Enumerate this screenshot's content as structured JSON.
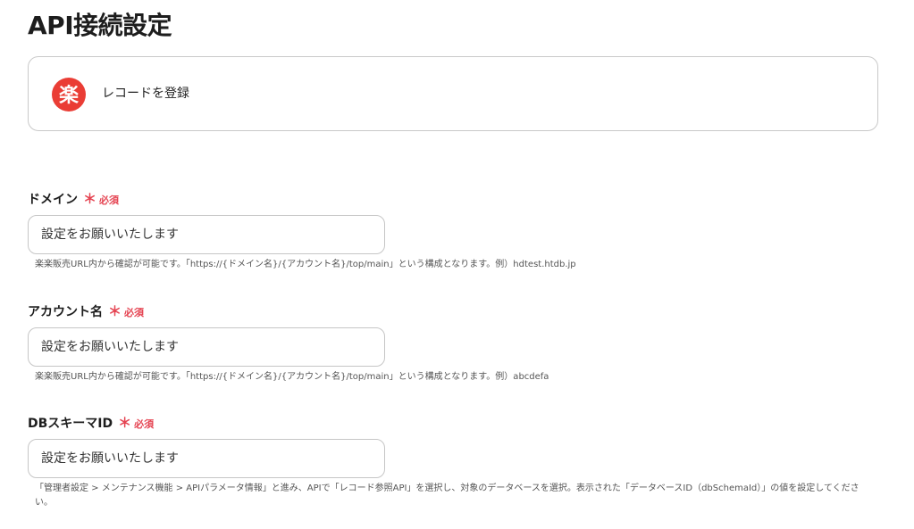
{
  "page": {
    "title": "API接続設定"
  },
  "app_card": {
    "logo_icon": "rakuten-logo-icon",
    "logo_char": "楽",
    "logo_color": "#ea3d35",
    "action": "レコードを登録"
  },
  "colors": {
    "required": "#e54452",
    "border": "#c6c6c6"
  },
  "fields": [
    {
      "label": "ドメイン",
      "required_mark": "＊",
      "required_text": "必須",
      "placeholder": "設定をお願いいたします",
      "help": "楽楽販売URL内から確認が可能です。「https://{ドメイン名}/{アカウント名}/top/main」という構成となります。例）hdtest.htdb.jp"
    },
    {
      "label": "アカウント名",
      "required_mark": "＊",
      "required_text": "必須",
      "placeholder": "設定をお願いいたします",
      "help": "楽楽販売URL内から確認が可能です。「https://{ドメイン名}/{アカウント名}/top/main」という構成となります。例）abcdefa"
    },
    {
      "label": "DBスキーマID",
      "required_mark": "＊",
      "required_text": "必須",
      "placeholder": "設定をお願いいたします",
      "help": "「管理者設定 > メンテナンス機能 > APIパラメータ情報」と進み、APIで「レコード参照API」を選択し、対象のデータベースを選択。表示された「データベースID（dbSchemaId）」の値を設定してください。"
    }
  ]
}
